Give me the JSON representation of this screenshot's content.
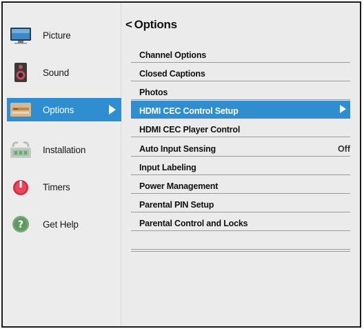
{
  "sidebar": {
    "items": [
      {
        "label": "Picture",
        "icon": "monitor-icon"
      },
      {
        "label": "Sound",
        "icon": "speaker-icon"
      },
      {
        "label": "Options",
        "icon": "options-icon"
      },
      {
        "label": "Installation",
        "icon": "installation-icon"
      },
      {
        "label": "Timers",
        "icon": "timer-icon"
      },
      {
        "label": "Get Help",
        "icon": "help-icon"
      }
    ],
    "active_index": 2
  },
  "panel": {
    "back_glyph": "<",
    "title": "Options",
    "items": [
      {
        "label": "Channel Options",
        "value": ""
      },
      {
        "label": "Closed Captions",
        "value": ""
      },
      {
        "label": "Photos",
        "value": ""
      },
      {
        "label": "HDMI CEC Control Setup",
        "value": ""
      },
      {
        "label": "HDMI CEC Player Control",
        "value": ""
      },
      {
        "label": "Auto Input Sensing",
        "value": "Off"
      },
      {
        "label": "Input Labeling",
        "value": ""
      },
      {
        "label": "Power Management",
        "value": ""
      },
      {
        "label": "Parental PIN Setup",
        "value": ""
      },
      {
        "label": "Parental Control and Locks",
        "value": ""
      }
    ],
    "active_index": 3
  },
  "colors": {
    "accent": "#2f8ed0",
    "background": "#ebebeb"
  }
}
